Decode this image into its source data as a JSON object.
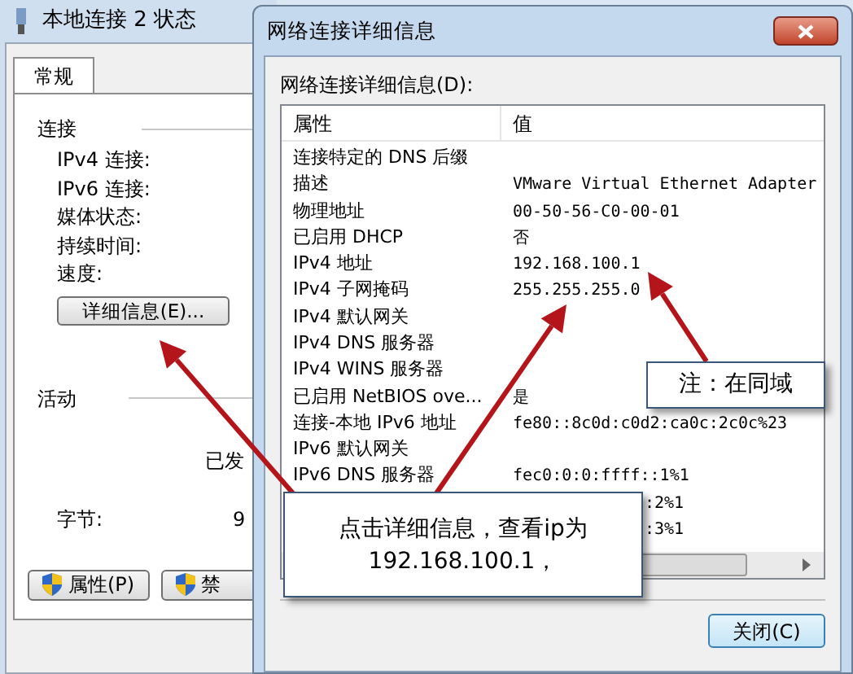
{
  "status_window": {
    "title": "本地连接 2 状态",
    "tabs": [
      {
        "label": "常规",
        "selected": true
      }
    ],
    "connection": {
      "heading": "连接",
      "labels": [
        "IPv4 连接:",
        "IPv6 连接:",
        "媒体状态:",
        "持续时间:",
        "速度:"
      ],
      "details_button": "详细信息(E)..."
    },
    "activity": {
      "heading": "活动",
      "sent": "已发",
      "bytes_label": "字节:",
      "bytes_value": "9"
    },
    "buttons": [
      "属性(P)",
      "禁"
    ]
  },
  "details_dialog": {
    "title": "网络连接详细信息",
    "list_label": "网络连接详细信息(D):",
    "columns": [
      "属性",
      "值"
    ],
    "rows": [
      {
        "property": "连接特定的 DNS 后缀",
        "value": ""
      },
      {
        "property": "描述",
        "value": "VMware Virtual Ethernet Adapter"
      },
      {
        "property": "物理地址",
        "value": "00-50-56-C0-00-01"
      },
      {
        "property": "已启用 DHCP",
        "value": "否"
      },
      {
        "property": "IPv4 地址",
        "value": "192.168.100.1"
      },
      {
        "property": "IPv4 子网掩码",
        "value": "255.255.255.0"
      },
      {
        "property": "IPv4 默认网关",
        "value": ""
      },
      {
        "property": "IPv4 DNS 服务器",
        "value": ""
      },
      {
        "property": "IPv4 WINS 服务器",
        "value": ""
      },
      {
        "property": "已启用 NetBIOS ove...",
        "value": "是"
      },
      {
        "property": "连接-本地 IPv6 地址",
        "value": "fe80::8c0d:c0d2:ca0c:2c0c%23"
      },
      {
        "property": "IPv6 默认网关",
        "value": ""
      },
      {
        "property": "IPv6 DNS 服务器",
        "value": "fec0:0:0:ffff::1%1"
      },
      {
        "property": "",
        "value": ":2%1"
      },
      {
        "property": "",
        "value": ":3%1"
      }
    ],
    "close_button": "关闭(C)"
  },
  "callouts": [
    "注：在同域",
    "点击详细信息，查看ip为\n192.168.100.1，"
  ]
}
